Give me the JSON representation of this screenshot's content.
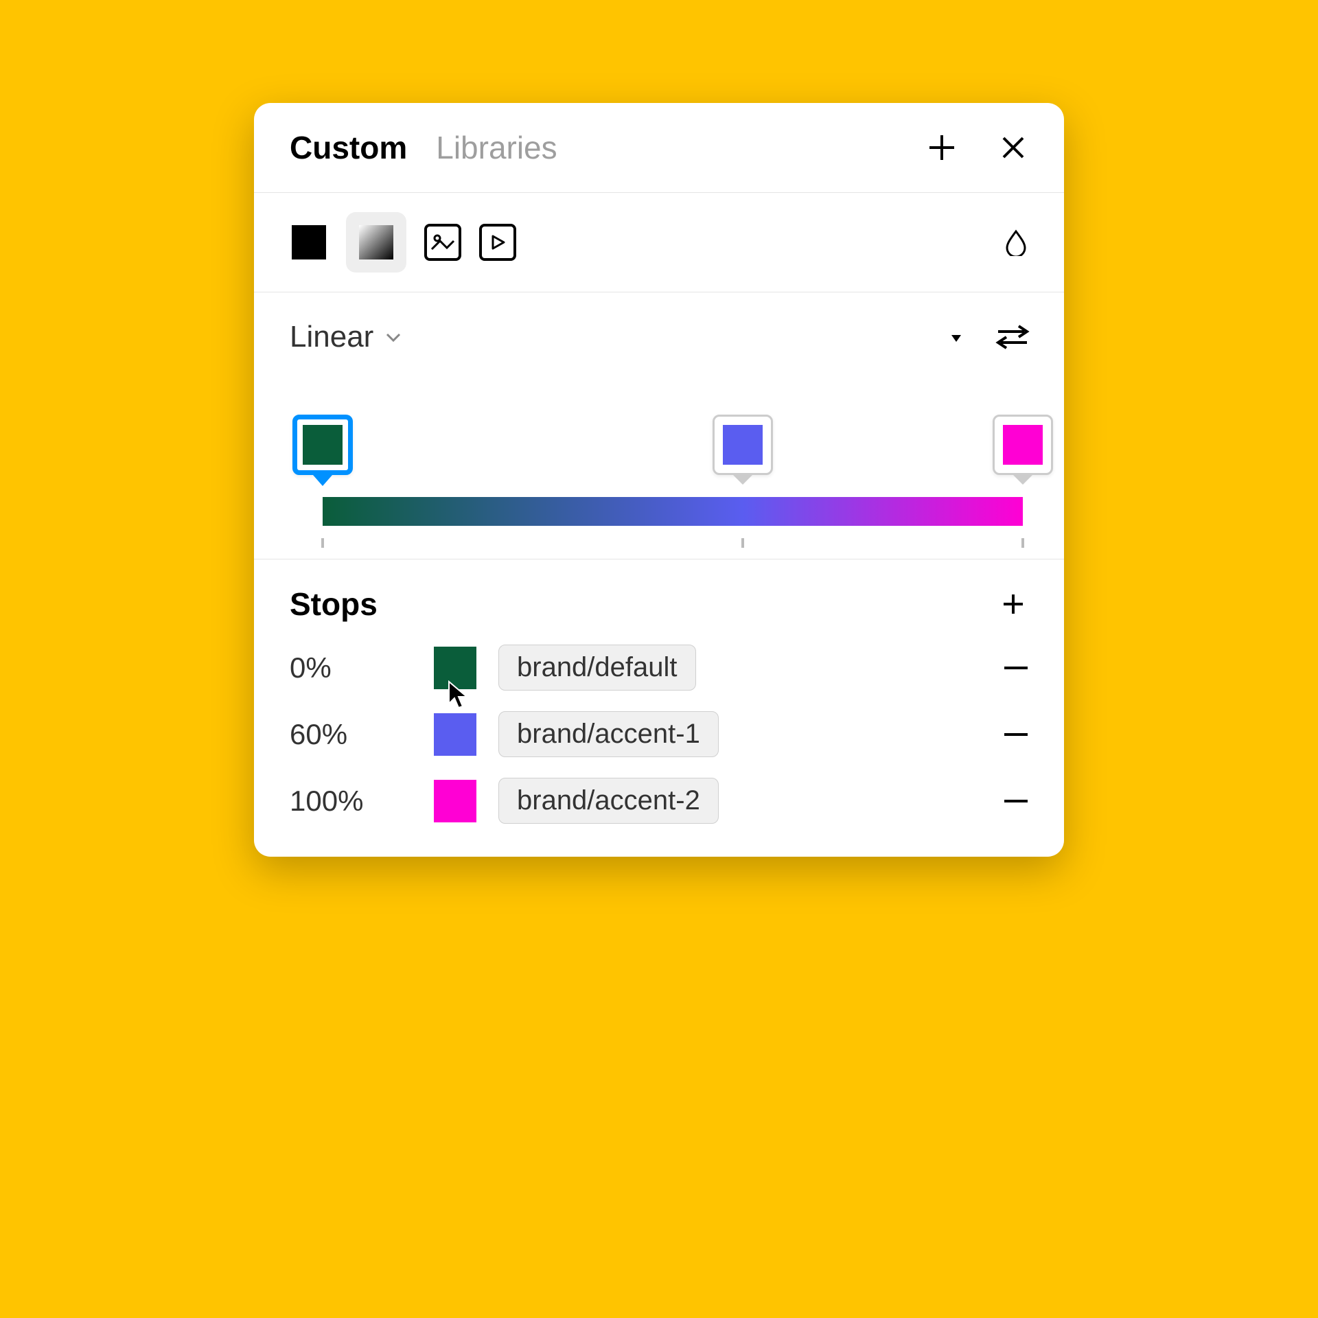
{
  "header": {
    "tabs": [
      {
        "label": "Custom",
        "active": true
      },
      {
        "label": "Libraries",
        "active": false
      }
    ]
  },
  "gradient": {
    "type_label": "Linear",
    "stops": [
      {
        "position": 0,
        "percent_label": "0%",
        "color": "#0a5d3a",
        "token": "brand/default",
        "selected": true
      },
      {
        "position": 60,
        "percent_label": "60%",
        "color": "#5a5df0",
        "token": "brand/accent-1",
        "selected": false
      },
      {
        "position": 100,
        "percent_label": "100%",
        "color": "#ff00d4",
        "token": "brand/accent-2",
        "selected": false
      }
    ]
  },
  "stops_section": {
    "title": "Stops"
  },
  "colors": {
    "background": "#ffc400",
    "selection": "#0091ff"
  }
}
